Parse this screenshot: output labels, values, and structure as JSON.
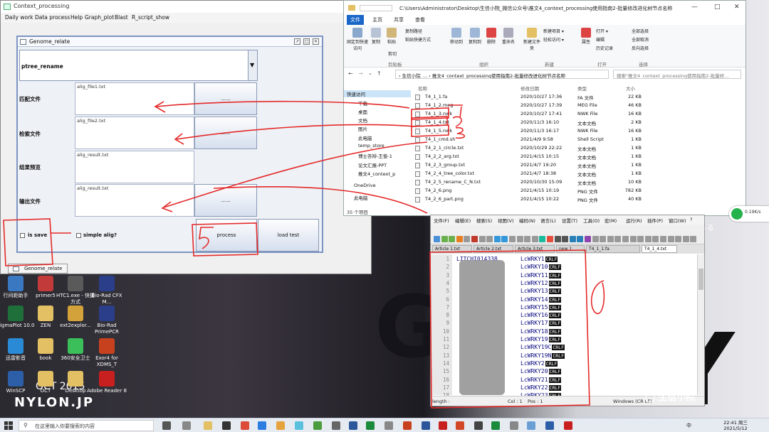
{
  "cp_window": {
    "title": "Context_processing",
    "menu": [
      "Daily work",
      "Data process",
      "Help",
      "Graph_plot",
      "Blast",
      "R_script_show"
    ],
    "frame_title": "Genome_relate",
    "frame_buttons": [
      "↗",
      "□",
      "✕"
    ],
    "combo_value": "ptree_rename",
    "rows": [
      {
        "label": "匹配文件",
        "file": "alig_file1.txt",
        "button": "......"
      },
      {
        "label": "检索文件",
        "file": "alig_file2.txt",
        "button": "......"
      },
      {
        "label": "结果预览",
        "file": "alig_result.txt",
        "button": ""
      },
      {
        "label": "输出文件",
        "file": "alig_result.txt",
        "button": "......"
      }
    ],
    "is_save_label": "is save",
    "simple_alig_label": "simple alig?",
    "process_label": "process",
    "load_test_label": "load test",
    "taskbar_tab_label": "Genome_relate"
  },
  "explorer": {
    "path": "C:\\Users\\Administrator\\Desktop\\生信小院_微信公众号\\推文4_context_processing使用指南2-批量修改进化树节点名称",
    "window_controls": [
      "—",
      "□",
      "✕"
    ],
    "tabs": [
      "文件",
      "主页",
      "共享",
      "查看"
    ],
    "ribbon": {
      "clipboard": [
        "固定到快速访问",
        "复制",
        "粘贴",
        "复制路径",
        "粘贴快捷方式",
        "剪切"
      ],
      "organize": [
        "移动到",
        "复制到",
        "删除",
        "重命名"
      ],
      "new": [
        "新建项目 ▾",
        "轻松访问 ▾",
        "新建文件夹"
      ],
      "open": [
        "属性",
        "打开 ▾",
        "编辑",
        "历史记录"
      ],
      "select": [
        "全部选择",
        "全部取消",
        "反向选择"
      ],
      "groups": [
        "剪贴板",
        "组织",
        "新建",
        "打开",
        "选择"
      ]
    },
    "address": "›  生信小院_...  ›  推文4_context_processing使用指南2-批量修改进化树节点名称",
    "search_placeholder": "搜索\"推文4_context_processing使用指南2-批量修...",
    "nav": [
      "快速访问",
      "下载",
      "桌面",
      "文档",
      "图片",
      "此电脑",
      "temp_store",
      "博士答辩-王俊-1",
      "论文汇报-PPT",
      "推文4_context_p",
      "OneDrive",
      "此电脑"
    ],
    "columns": [
      "名称",
      "修改日期",
      "类型",
      "大小"
    ],
    "files": [
      {
        "name": "T4_1_1.fa",
        "date": "2020/10/27 17:36",
        "type": "FA 文件",
        "size": "22 KB"
      },
      {
        "name": "T4_1_2.meg",
        "date": "2020/10/27 17:39",
        "type": "MEG File",
        "size": "46 KB"
      },
      {
        "name": "T4_1_3.nwk",
        "date": "2020/10/27 17:41",
        "type": "NWK File",
        "size": "16 KB"
      },
      {
        "name": "T4_1_4.txt",
        "date": "2020/11/3 16:10",
        "type": "文本文档",
        "size": "2 KB"
      },
      {
        "name": "T4_1_5.nwk",
        "date": "2020/11/3 16:17",
        "type": "NWK File",
        "size": "16 KB"
      },
      {
        "name": "T4_1_cmd.sh",
        "date": "2021/4/9 9:58",
        "type": "Shell Script",
        "size": "1 KB"
      },
      {
        "name": "T4_2_1_circle.txt",
        "date": "2020/10/29 22:22",
        "type": "文本文档",
        "size": "1 KB"
      },
      {
        "name": "T4_2_2_arg.txt",
        "date": "2021/4/15 10:15",
        "type": "文本文档",
        "size": "1 KB"
      },
      {
        "name": "T4_2_3_group.txt",
        "date": "2021/4/7 19:20",
        "type": "文本文档",
        "size": "1 KB"
      },
      {
        "name": "T4_2_4_tree_color.txt",
        "date": "2021/4/7 18:38",
        "type": "文本文档",
        "size": "1 KB"
      },
      {
        "name": "T4_2_5_rename_C_N.txt",
        "date": "2020/10/30 15:09",
        "type": "文本文档",
        "size": "10 KB"
      },
      {
        "name": "T4_2_6.png",
        "date": "2021/4/15 10:19",
        "type": "PNG 文件",
        "size": "782 KB"
      },
      {
        "name": "T4_2_6_part.png",
        "date": "2021/4/15 10:22",
        "type": "PNG 文件",
        "size": "40 KB"
      }
    ],
    "status": "35 个项目"
  },
  "editor": {
    "menu": [
      "文件(F)",
      "编辑(E)",
      "搜索(S)",
      "视图(V)",
      "编码(N)",
      "语言(L)",
      "设置(T)",
      "工具(O)",
      "宏(M)",
      "运行(R)",
      "插件(P)",
      "窗口(W)",
      "?"
    ],
    "tabs": [
      "Article 1.txt",
      "Article 2.txt",
      "Article 3.txt",
      "new 1",
      "T4_1_1.fa",
      "T4_1_4.txt"
    ],
    "line_numbers": [
      "1",
      "2",
      "3",
      "4",
      "5",
      "6",
      "7",
      "8",
      "9",
      "10",
      "11",
      "12",
      "13",
      "14",
      "15",
      "16",
      "17",
      "18"
    ],
    "first_col": "LITCHI014338",
    "lines": [
      "LcWRKY1",
      "LcWRKY10",
      "LcWRKY11",
      "LcWRKY12",
      "LcWRKY13",
      "LcWRKY14",
      "LcWRKY15",
      "LcWRKY16",
      "LcWRKY17",
      "LcWRKY18",
      "LcWRKY19",
      "LcWRKY19C",
      "LcWRKY19N",
      "LcWRKY2",
      "LcWRKY20",
      "LcWRKY21",
      "LcWRKY22",
      "LcWRKY23"
    ],
    "crlf": "CRLF",
    "status": {
      "length": "length :",
      "col": "Col : 1",
      "pos": "Pos : 1",
      "eol": "Windows (CR LF)"
    }
  },
  "annotations": [
    "1",
    "2",
    "3",
    "5",
    "6"
  ],
  "desktop": {
    "icons": [
      "行间距助手",
      "primer5",
      "HTC1.exe - 快捷方式",
      "Bio-Rad CFX M...",
      "SigmaPlot 10.0",
      "ZEN",
      "ext2explor...",
      "Bio-Rad PrimePCR",
      "迅雷影音",
      "book",
      "360安全卫士",
      "Exor4 for XDMS_T",
      "WinSCP",
      "OCT",
      "Desktop",
      "Adobe Reader 8"
    ],
    "bg_text": "NYLON.JP",
    "bg_date": "OCT 2015",
    "bg_big": [
      "G",
      "N",
      "Y"
    ],
    "bg_small": "って ぁる angel"
  },
  "netspeed": "0.19K/s",
  "taskbar": {
    "search_placeholder": "在这里输入你要搜索的内容",
    "time": "22:41 周三",
    "date": "2021/5/12",
    "lang": "中"
  },
  "watermark": "生信小院"
}
